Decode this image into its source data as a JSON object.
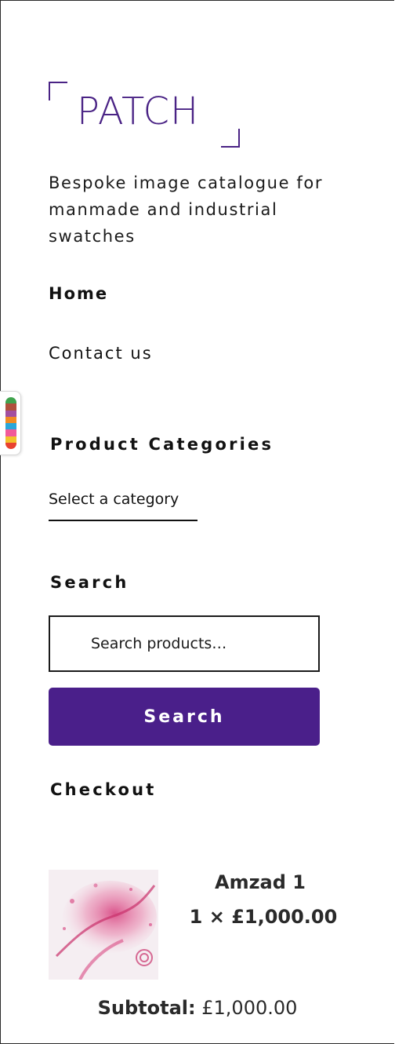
{
  "site": {
    "logo_text": "PATCH",
    "logo_color": "#4a2385",
    "tagline": "Bespoke image catalogue for manmade and industrial swatches"
  },
  "nav": {
    "home": "Home",
    "contact": "Contact us"
  },
  "palette_tab": {
    "icon": "color-palette-icon",
    "stripe_colors": [
      "#3fa34d",
      "#b0503c",
      "#a34fa0",
      "#f08a24",
      "#2aa6d9",
      "#f15a9a",
      "#f2c22c",
      "#e8422f"
    ]
  },
  "product_categories": {
    "title": "Product Categories",
    "select_value": "Select a category"
  },
  "search": {
    "title": "Search",
    "placeholder": "Search products…",
    "button_label": "Search",
    "button_color": "#4a1f8a"
  },
  "checkout": {
    "title": "Checkout",
    "item": {
      "name": "Amzad 1",
      "quantity_line": "1 × £1,000.00"
    },
    "subtotal_label": "Subtotal:",
    "subtotal_value": "£1,000.00"
  }
}
